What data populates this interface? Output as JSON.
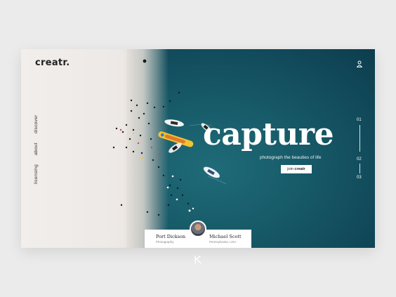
{
  "brand": {
    "logo": "creatr."
  },
  "nav": {
    "items": [
      {
        "label": "discover"
      },
      {
        "label": "about"
      },
      {
        "label": "licensing"
      }
    ]
  },
  "hero": {
    "title": "capture",
    "subtitle": "photograph the beauties of life",
    "cta_prefix": "join",
    "cta_brand": "creatr"
  },
  "pager": {
    "pages": [
      "01",
      "02",
      "03"
    ],
    "current": "01"
  },
  "card": {
    "left": {
      "name": "Port Dickson",
      "role": "Photography"
    },
    "right": {
      "name": "Michael Scott",
      "role": "Pennsylvania, USA"
    }
  },
  "colors": {
    "sea": "#175a68",
    "sand": "#ede9e6",
    "text_dark": "#222222",
    "white": "#ffffff"
  },
  "icons": {
    "user": "user-icon",
    "bottom": "dribbble-style-logo-icon"
  }
}
